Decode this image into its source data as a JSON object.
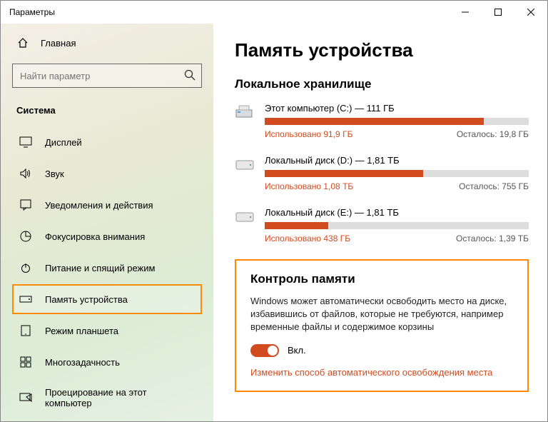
{
  "window": {
    "title": "Параметры"
  },
  "sidebar": {
    "home": "Главная",
    "search_placeholder": "Найти параметр",
    "section": "Система",
    "items": [
      {
        "label": "Дисплей"
      },
      {
        "label": "Звук"
      },
      {
        "label": "Уведомления и действия"
      },
      {
        "label": "Фокусировка внимания"
      },
      {
        "label": "Питание и спящий режим"
      },
      {
        "label": "Память устройства"
      },
      {
        "label": "Режим планшета"
      },
      {
        "label": "Многозадачность"
      },
      {
        "label": "Проецирование на этот компьютер"
      }
    ]
  },
  "main": {
    "title": "Память устройства",
    "local_storage": "Локальное хранилище",
    "drives": [
      {
        "name": "Этот компьютер (C:) — 111 ГБ",
        "used": "Использовано 91,9 ГБ",
        "remain": "Осталось: 19,8 ГБ",
        "pct": 83
      },
      {
        "name": "Локальный диск (D:) — 1,81 ТБ",
        "used": "Использовано 1,08 ТБ",
        "remain": "Осталось: 755 ГБ",
        "pct": 60
      },
      {
        "name": "Локальный диск (E:) — 1,81 ТБ",
        "used": "Использовано 438 ГБ",
        "remain": "Осталось: 1,39 ТБ",
        "pct": 24
      }
    ],
    "control": {
      "title": "Контроль памяти",
      "desc": "Windows может автоматически освободить место на диске, избавившись от файлов, которые не требуются, например временные файлы и содержимое корзины",
      "toggle_label": "Вкл.",
      "link": "Изменить способ автоматического освобождения места"
    }
  }
}
